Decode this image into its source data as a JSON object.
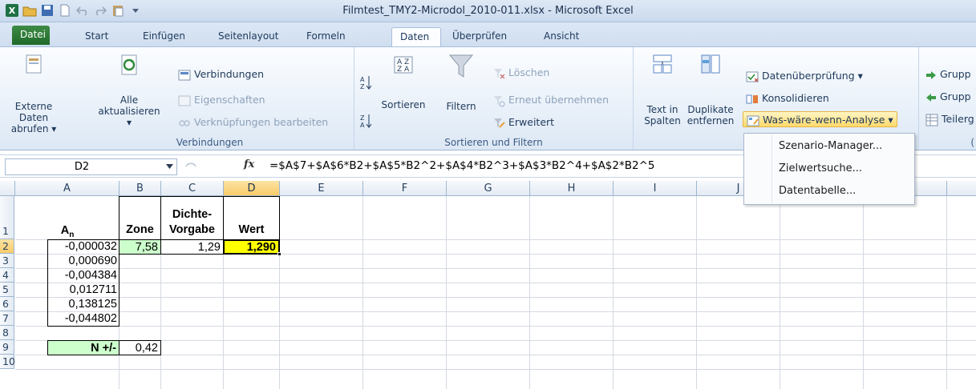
{
  "window": {
    "title": "Filmtest_TMY2-Microdol_2010-011.xlsx  -  Microsoft Excel"
  },
  "tabs": [
    {
      "label": "Datei"
    },
    {
      "label": "Start"
    },
    {
      "label": "Einfügen"
    },
    {
      "label": "Seitenlayout"
    },
    {
      "label": "Formeln"
    },
    {
      "label": "Daten"
    },
    {
      "label": "Überprüfen"
    },
    {
      "label": "Ansicht"
    }
  ],
  "ribbon": {
    "external": {
      "line1": "Externe Daten",
      "line2": "abrufen ▾"
    },
    "refresh": {
      "line1": "Alle",
      "line2": "aktualisieren ▾"
    },
    "connections": {
      "connections": "Verbindungen",
      "properties": "Eigenschaften",
      "edit_links": "Verknüpfungen bearbeiten",
      "group": "Verbindungen"
    },
    "sort": {
      "sort_label": "Sortieren",
      "filter_label": "Filtern",
      "clear": "Löschen",
      "reapply": "Erneut übernehmen",
      "advanced": "Erweitert",
      "group": "Sortieren und Filtern"
    },
    "tools": {
      "text_cols_1": "Text in",
      "text_cols_2": "Spalten",
      "dup_1": "Duplikate",
      "dup_2": "entfernen",
      "validation": "Datenüberprüfung ▾",
      "consolidate": "Konsolidieren",
      "whatif": "Was-wäre-wenn-Analyse ▾"
    },
    "outline": {
      "group1": "Grupp",
      "group2": "Grupp",
      "subtotal": "Teilerg",
      "group_label": "("
    }
  },
  "dropdown": {
    "items": [
      {
        "label": "Szenario-Manager..."
      },
      {
        "label": "Zielwertsuche..."
      },
      {
        "label": "Datentabelle..."
      }
    ]
  },
  "formula_bar": {
    "name_box": "D2",
    "fx": "fx",
    "formula": "=$A$7+$A$6*B2+$A$5*B2^2+$A$4*B2^3+$A$3*B2^4+$A$2*B2^5"
  },
  "grid": {
    "columns": [
      "A",
      "B",
      "C",
      "D",
      "E",
      "F",
      "G",
      "H",
      "I",
      "J"
    ],
    "rows": [
      "1",
      "2",
      "3",
      "4",
      "5",
      "6",
      "7",
      "8",
      "9",
      "10"
    ],
    "cells": {
      "A1": "A",
      "A1_sub": "n",
      "B1": "Zone",
      "C1_line1": "Dichte-",
      "C1_line2": "Vorgabe",
      "D1": "Wert",
      "A2": "-0,000032",
      "B2": "7,58",
      "C2": "1,29",
      "D2": "1,290",
      "A3": "0,000690",
      "A4": "-0,004384",
      "A5": "0,012711",
      "A6": "0,138125",
      "A7": "-0,044802",
      "A9": "N +/-",
      "B9": "0,42"
    }
  },
  "colors": {
    "zone_fill": "#ccffcc",
    "result_fill": "#ffff00",
    "selection": "#f9cb68"
  }
}
